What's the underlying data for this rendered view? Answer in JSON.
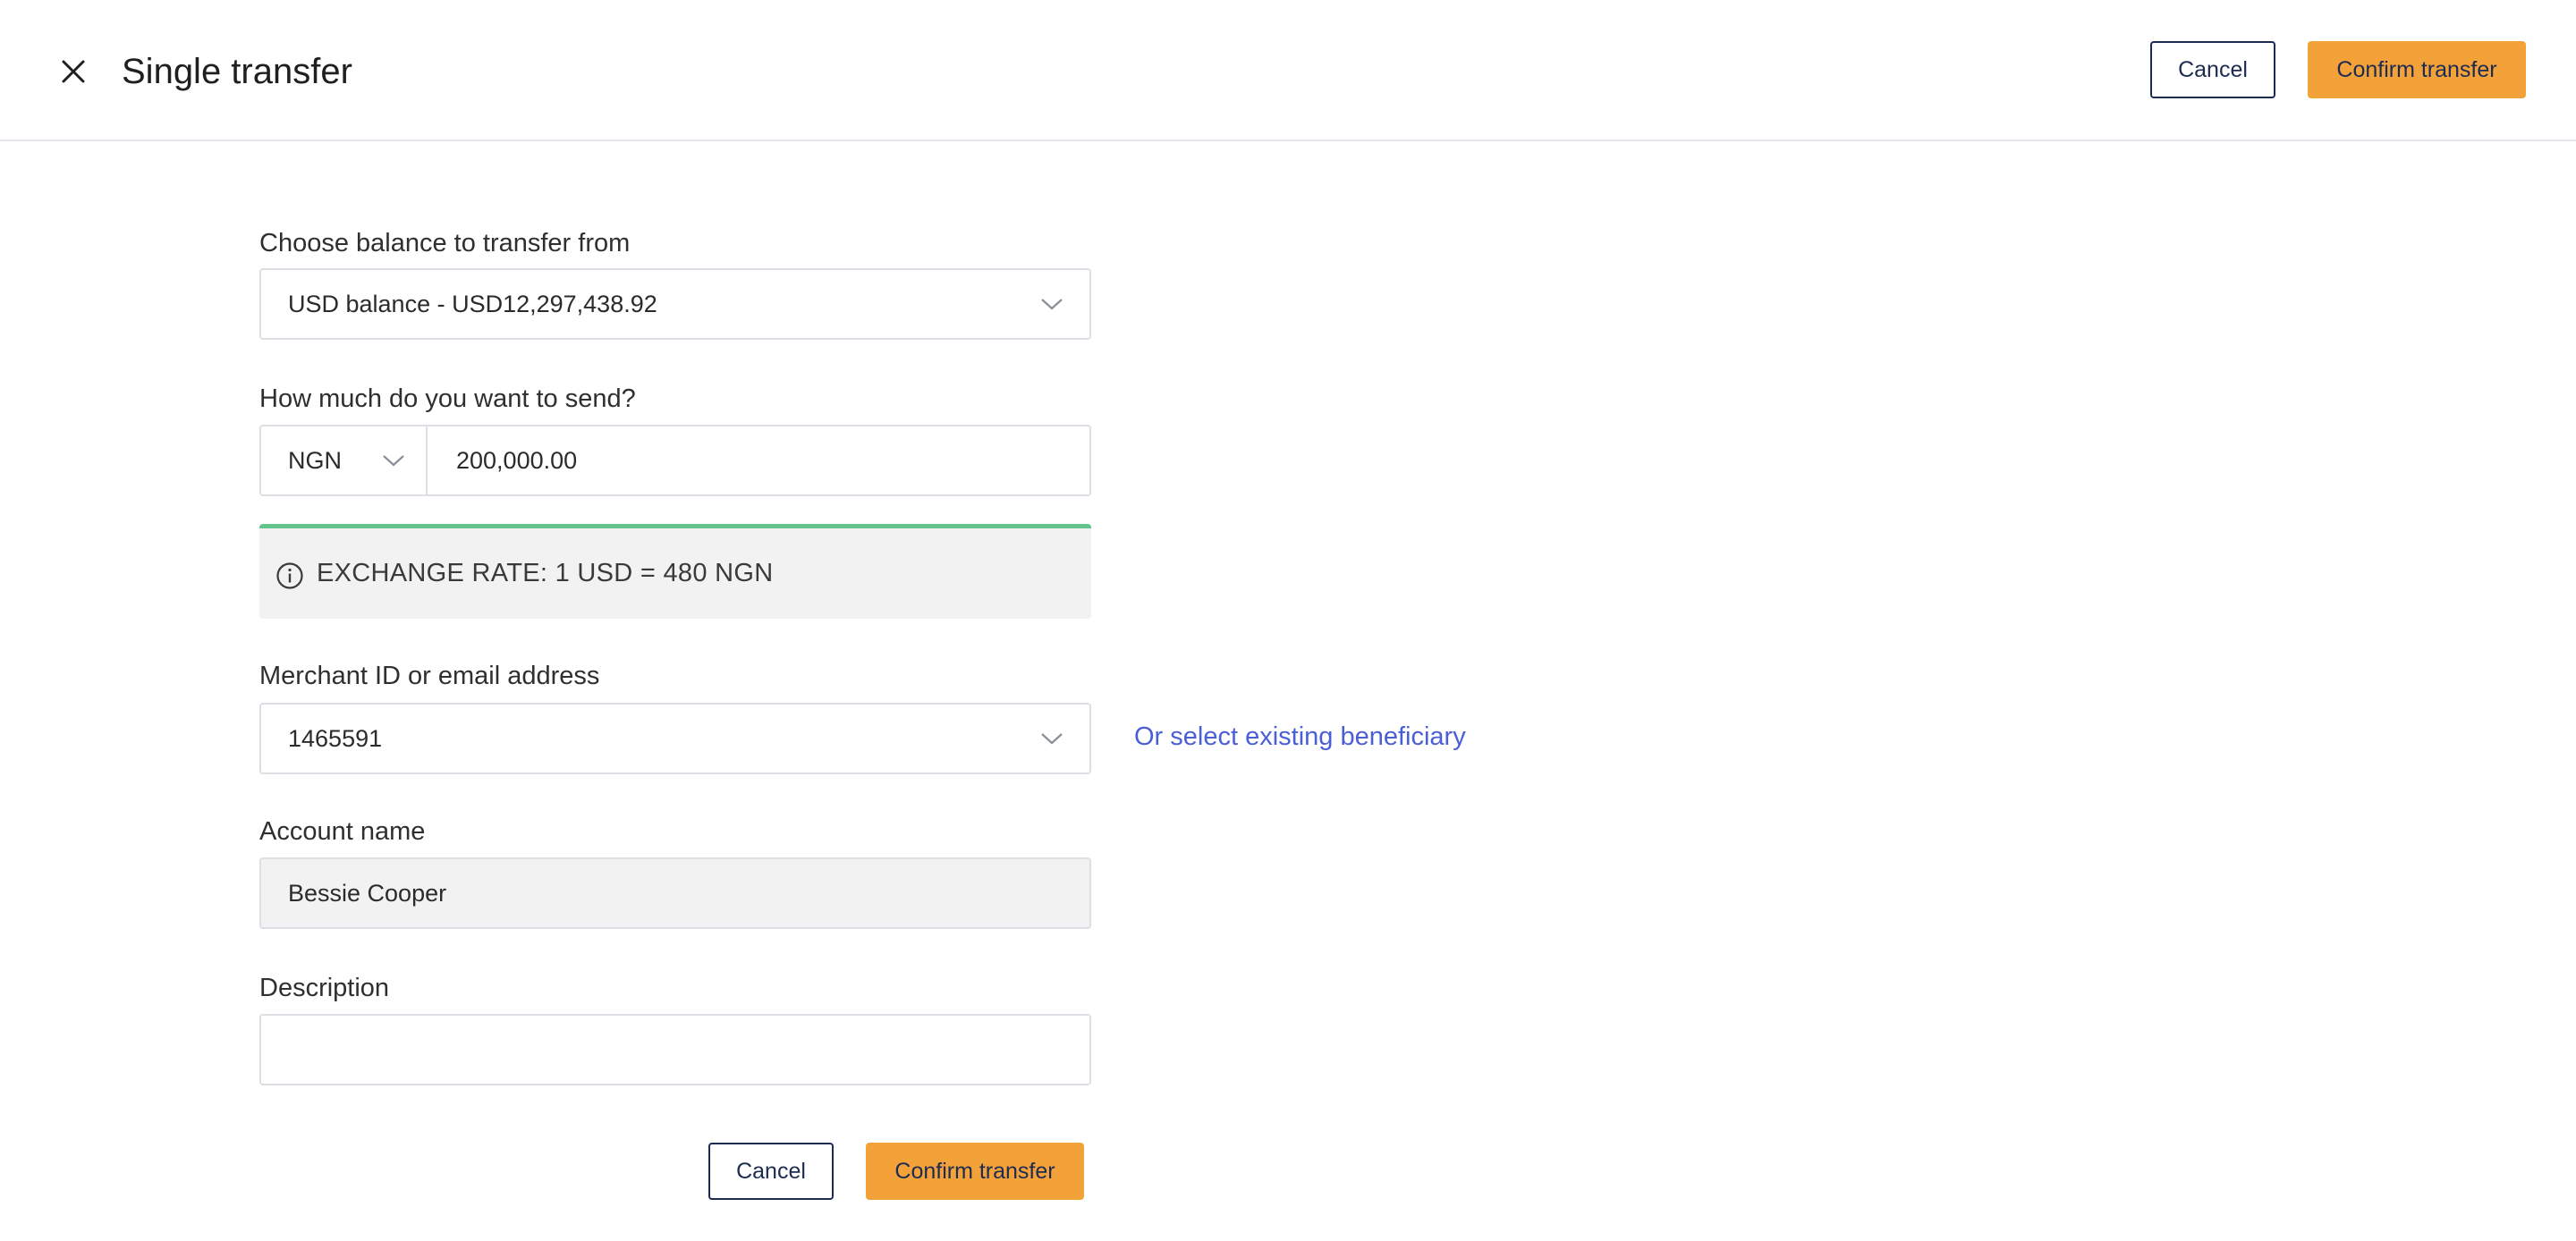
{
  "header": {
    "title": "Single transfer",
    "close_icon": "close-icon",
    "cancel_label": "Cancel",
    "confirm_label": "Confirm transfer"
  },
  "form": {
    "balance": {
      "label": "Choose balance to transfer from",
      "value": "USD balance - USD12,297,438.92"
    },
    "amount": {
      "label": "How much do you want to send?",
      "currency": "NGN",
      "value": "200,000.00"
    },
    "exchange_rate": {
      "text": "EXCHANGE RATE: 1 USD = 480 NGN",
      "icon": "info-icon"
    },
    "merchant": {
      "label": "Merchant ID or email address",
      "value": "1465591",
      "beneficiary_link": "Or select existing beneficiary"
    },
    "account_name": {
      "label": "Account name",
      "value": "Bessie Cooper"
    },
    "description": {
      "label": "Description",
      "value": ""
    }
  },
  "footer": {
    "cancel_label": "Cancel",
    "confirm_label": "Confirm transfer"
  },
  "colors": {
    "primary": "#f3a239",
    "navy": "#1d2b52",
    "link": "#4a5fd6",
    "success_bar": "#63c48a"
  }
}
